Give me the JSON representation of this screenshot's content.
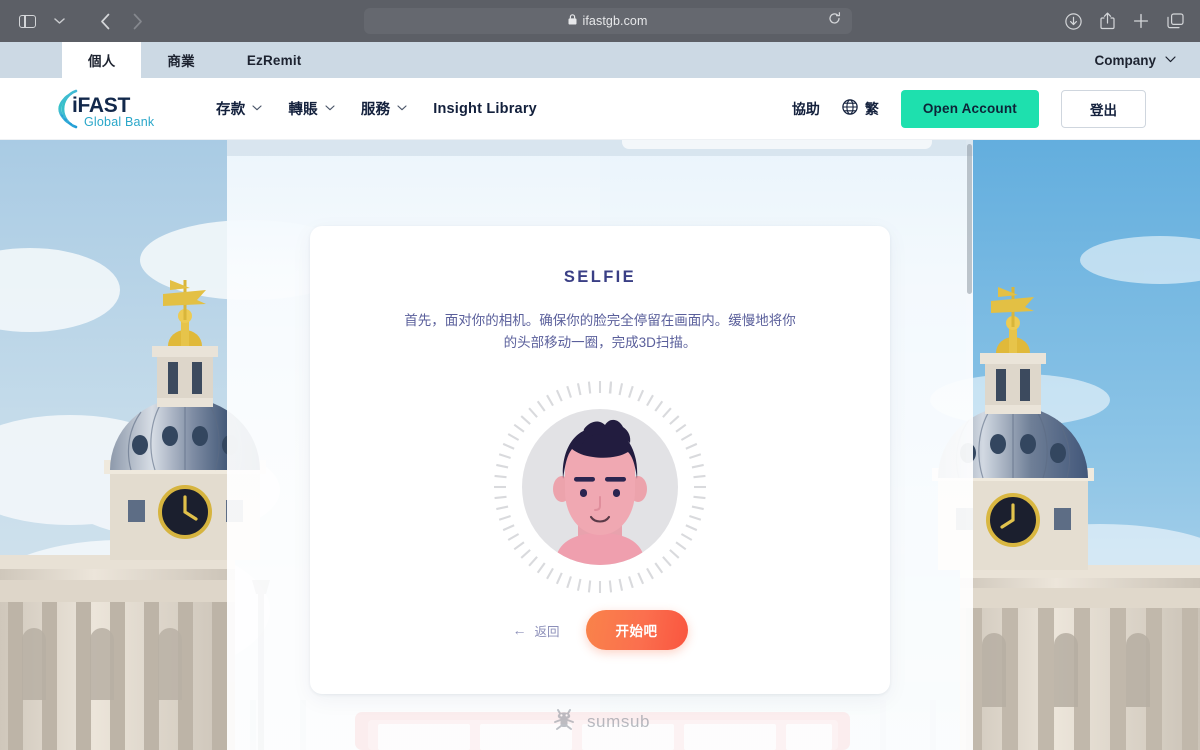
{
  "browser": {
    "url": "ifastgb.com",
    "icons": {
      "sidebar": "sidebar-toggle-icon",
      "sidebar_chevron": "chevron-down-icon",
      "back": "back-arrow-icon",
      "forward": "forward-arrow-icon",
      "shield": "shield-privacy-icon",
      "lock": "lock-icon",
      "reload": "reload-icon",
      "downloads": "downloads-icon",
      "share": "share-icon",
      "new_tab": "plus-icon",
      "tab_overview": "tab-overview-icon"
    }
  },
  "tabstrip": {
    "tabs": [
      {
        "label": "個人",
        "active": true
      },
      {
        "label": "商業",
        "active": false
      },
      {
        "label": "EzRemit",
        "active": false
      }
    ],
    "company_label": "Company",
    "company_chevron": "⌄"
  },
  "header": {
    "logo": {
      "name": "iFAST",
      "tagline": "Global Bank"
    },
    "nav": [
      {
        "label": "存款",
        "has_chevron": true
      },
      {
        "label": "轉賬",
        "has_chevron": true
      },
      {
        "label": "服務",
        "has_chevron": true
      },
      {
        "label": "Insight Library",
        "has_chevron": false
      }
    ],
    "help_label": "協助",
    "lang_label": "繁",
    "lang_icon": "globe-icon",
    "open_account_label": "Open Account",
    "logout_label": "登出"
  },
  "card": {
    "title": "SELFIE",
    "description": "首先，面对你的相机。确保你的脸完全停留在画面内。缓慢地将你的头部移动一圈，完成3D扫描。",
    "avatar_icon": "selfie-face-scan-icon",
    "back_label": "返回",
    "back_arrow": "←",
    "start_label": "开始吧"
  },
  "footer": {
    "brand": "sumsub",
    "brand_icon": "sumsub-logo-icon"
  },
  "colors": {
    "accent_teal": "#1ee0ae",
    "accent_orange": "#fb6f4e",
    "title_purple": "#3a3f85",
    "body_purple": "#5a5f9b",
    "tabstrip_bg": "#ccd9e4",
    "toolbar_bg": "#5c5f66"
  }
}
